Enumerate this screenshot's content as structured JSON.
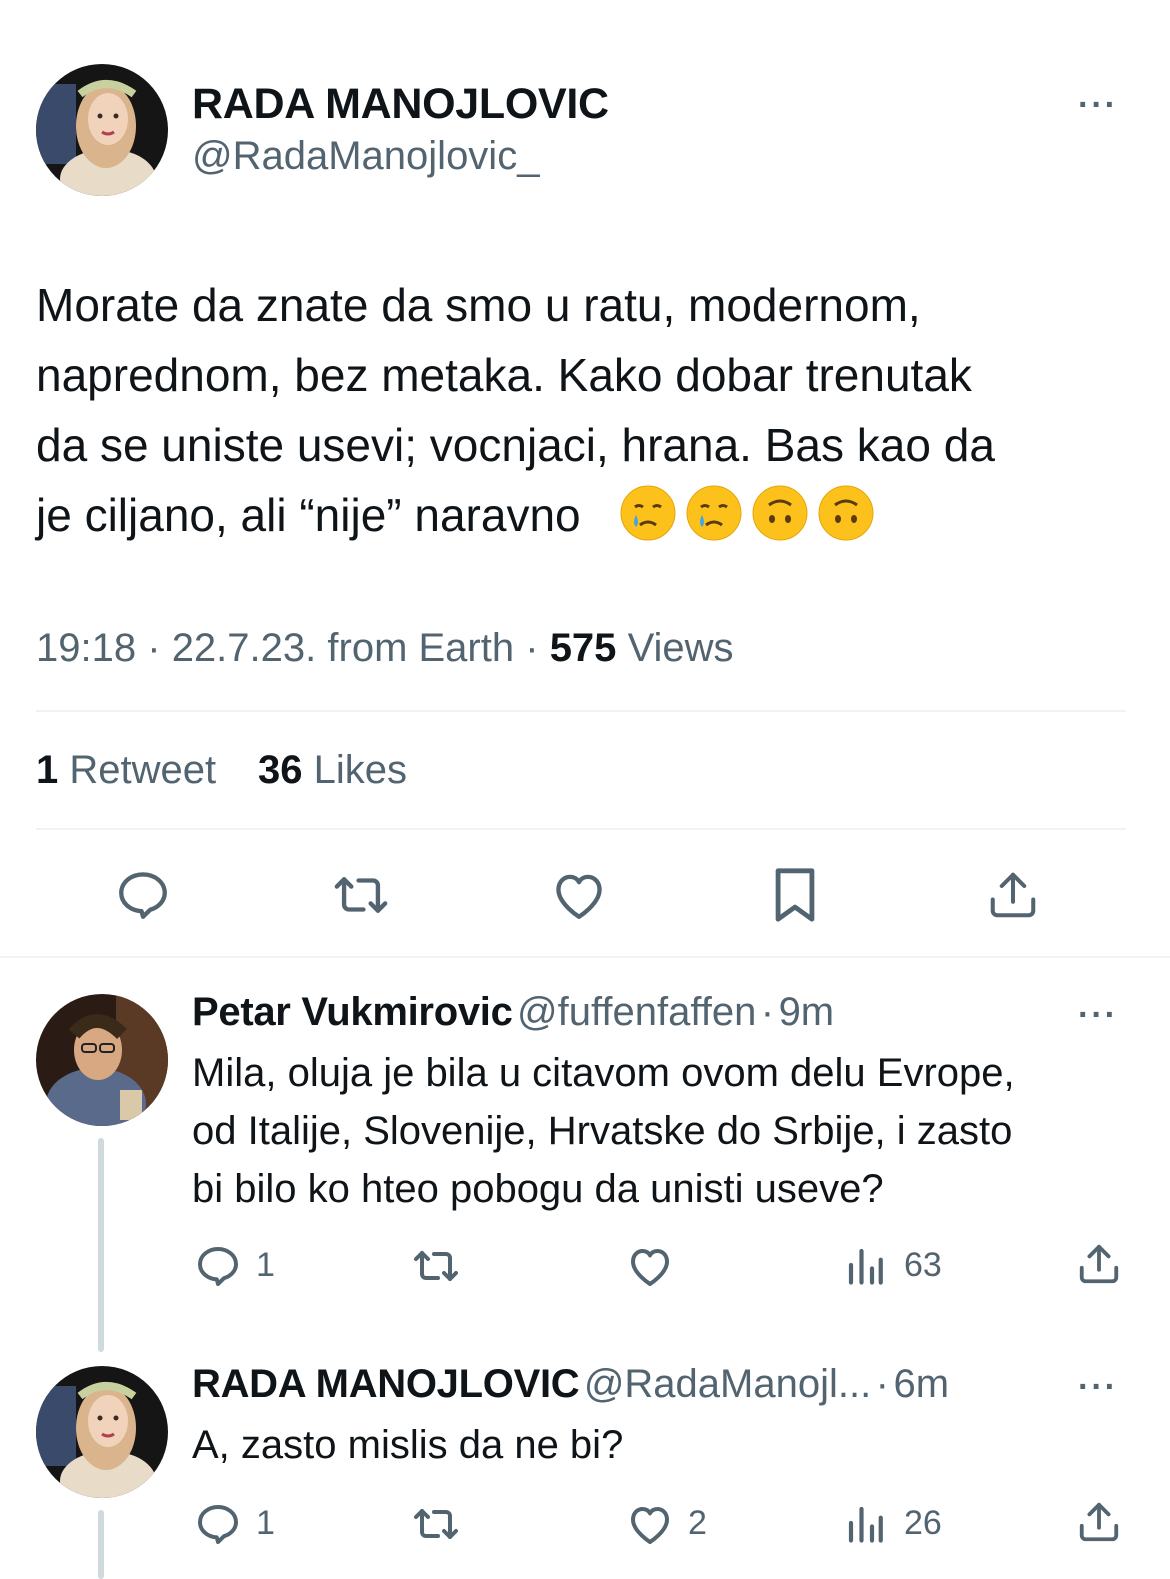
{
  "main_tweet": {
    "author_name": "RADA MANOJLOVIC",
    "author_handle": "@RadaManojlovic_",
    "more_label": "···",
    "text_lines": [
      "Morate da znate da smo u ratu, modernom,",
      "naprednom, bez metaka. Kako dobar trenutak",
      "da se uniste usevi; vocnjaci, hrana. Bas kao da",
      "je ciljano, ali “nije” naravno"
    ],
    "emojis": [
      "crying-face",
      "crying-face",
      "upside-down-face",
      "upside-down-face"
    ],
    "time": "19:18",
    "date": "22.7.23.",
    "source": "from Earth",
    "sep": "·",
    "views_count": "575",
    "views_label": "Views",
    "retweets_count": "1",
    "retweets_label": "Retweet",
    "likes_count": "36",
    "likes_label": "Likes",
    "actions": [
      "reply-icon",
      "retweet-icon",
      "like-icon",
      "bookmark-icon",
      "share-icon"
    ]
  },
  "replies": [
    {
      "author_name": "Petar Vukmirovic",
      "author_handle": "@fuffenfaffen",
      "time_ago": "9m",
      "sep": "·",
      "more_label": "···",
      "text_lines": [
        "Mila, oluja je bila u citavom ovom delu Evrope,",
        "od Italije, Slovenije, Hrvatske do Srbije, i zasto",
        "bi bilo ko hteo pobogu da unisti useve?"
      ],
      "reply_count": "1",
      "retweet_count": "",
      "like_count": "",
      "views_count": "63"
    },
    {
      "author_name": "RADA MANOJLOVIC",
      "author_handle": "@RadaManojl...",
      "time_ago": "6m",
      "sep": "·",
      "more_label": "···",
      "text_lines": [
        "A, zasto mislis da ne bi?"
      ],
      "reply_count": "1",
      "retweet_count": "",
      "like_count": "2",
      "views_count": "26"
    }
  ]
}
